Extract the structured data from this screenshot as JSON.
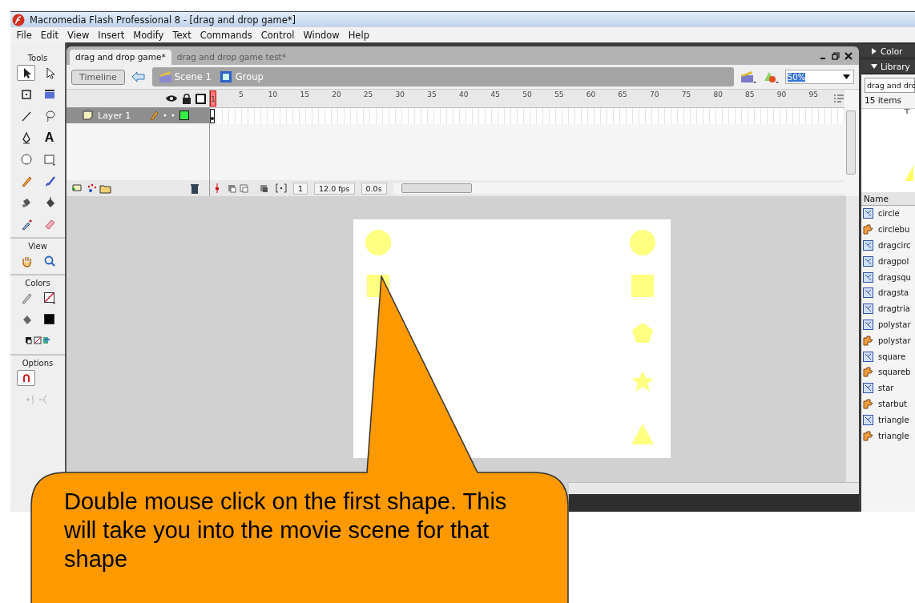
{
  "window": {
    "title": "Macromedia Flash Professional 8 - [drag and drop game*]"
  },
  "menu": [
    "File",
    "Edit",
    "View",
    "Insert",
    "Modify",
    "Text",
    "Commands",
    "Control",
    "Window",
    "Help"
  ],
  "tools_panel": {
    "sections": [
      {
        "label": "Tools",
        "tools": [
          {
            "kind": "arrow",
            "selected": true
          },
          {
            "kind": "subselect",
            "selected": false
          },
          {
            "kind": "free-transform",
            "selected": false
          },
          {
            "kind": "gradient",
            "selected": false
          },
          {
            "kind": "line",
            "selected": false
          },
          {
            "kind": "lasso",
            "selected": false
          },
          {
            "kind": "pen",
            "selected": false
          },
          {
            "kind": "text",
            "label": "A",
            "selected": false
          },
          {
            "kind": "oval",
            "selected": false
          },
          {
            "kind": "rectangle",
            "selected": false
          },
          {
            "kind": "pencil",
            "selected": false
          },
          {
            "kind": "brush",
            "selected": false
          },
          {
            "kind": "ink-bottle",
            "selected": false
          },
          {
            "kind": "paint-bucket",
            "selected": false
          },
          {
            "kind": "eyedropper",
            "selected": false
          },
          {
            "kind": "eraser",
            "selected": false
          }
        ]
      },
      {
        "label": "View",
        "tools": [
          {
            "kind": "hand",
            "selected": false
          },
          {
            "kind": "zoom",
            "selected": false
          }
        ]
      },
      {
        "label": "Colors",
        "tools": [
          {
            "kind": "stroke-color",
            "selected": false
          },
          {
            "kind": "no-color-swatch",
            "selected": false
          },
          {
            "kind": "fill-color",
            "selected": false
          },
          {
            "kind": "black-swatch",
            "selected": false
          },
          {
            "kind": "color-trio",
            "selected": false
          }
        ]
      },
      {
        "label": "Options",
        "tools": [
          {
            "kind": "snap",
            "selected": true
          },
          {
            "kind": "smooth-straighten",
            "selected": false
          }
        ]
      }
    ]
  },
  "document_tabs": [
    {
      "label": "drag and drop game*",
      "selected": true
    },
    {
      "label": "drag and drop game test*",
      "selected": false
    }
  ],
  "edit_bar": {
    "timeline_button": "Timeline",
    "breadcrumbs": [
      {
        "kind": "scene",
        "label": "Scene 1"
      },
      {
        "kind": "group",
        "label": "Group"
      }
    ],
    "zoom": "50%"
  },
  "timeline": {
    "layers": [
      {
        "name": "Layer 1",
        "selected": true
      }
    ],
    "ruler": [
      "1",
      "5",
      "10",
      "15",
      "20",
      "25",
      "30",
      "35",
      "40",
      "45",
      "50",
      "55",
      "60",
      "65",
      "70",
      "75",
      "80",
      "85",
      "90",
      "95"
    ],
    "current_frame": "1",
    "frame_rate": "12.0 fps",
    "elapsed": "0.0s"
  },
  "stage": {
    "left_column": [
      {
        "kind": "circle"
      },
      {
        "kind": "square"
      }
    ],
    "right_column": [
      {
        "kind": "circle"
      },
      {
        "kind": "square"
      },
      {
        "kind": "pentagon"
      },
      {
        "kind": "star"
      },
      {
        "kind": "triangle"
      }
    ]
  },
  "right_panel": {
    "panels": [
      {
        "title": "Color",
        "expanded": false
      },
      {
        "title": "Library",
        "expanded": true
      }
    ],
    "library": {
      "document": "drag and dro",
      "count": "15 items",
      "column": "Name",
      "items": [
        {
          "name": "circle",
          "kind": "graphic"
        },
        {
          "name": "circlebu",
          "kind": "button"
        },
        {
          "name": "dragcirc",
          "kind": "graphic"
        },
        {
          "name": "dragpol",
          "kind": "graphic"
        },
        {
          "name": "dragsqu",
          "kind": "graphic"
        },
        {
          "name": "dragsta",
          "kind": "graphic"
        },
        {
          "name": "dragtria",
          "kind": "graphic"
        },
        {
          "name": "polystar",
          "kind": "graphic"
        },
        {
          "name": "polystar",
          "kind": "button"
        },
        {
          "name": "square",
          "kind": "graphic"
        },
        {
          "name": "squareb",
          "kind": "button"
        },
        {
          "name": "star",
          "kind": "graphic"
        },
        {
          "name": "starbut",
          "kind": "button"
        },
        {
          "name": "triangle",
          "kind": "graphic"
        },
        {
          "name": "triangle",
          "kind": "button"
        }
      ]
    }
  },
  "callout": {
    "text": "Double mouse click on the first shape. This will take you into the movie scene for that shape"
  }
}
